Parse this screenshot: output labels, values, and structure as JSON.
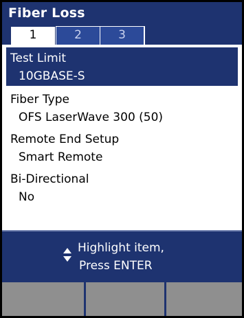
{
  "screen": {
    "title": "Fiber Loss",
    "tabs": [
      {
        "label": "1",
        "active": true
      },
      {
        "label": "2",
        "active": false
      },
      {
        "label": "3",
        "active": false
      }
    ]
  },
  "settings": [
    {
      "label": "Test Limit",
      "value": "10GBASE-S",
      "selected": true
    },
    {
      "label": "Fiber Type",
      "value": "OFS LaserWave 300 (50)",
      "selected": false
    },
    {
      "label": "Remote End Setup",
      "value": "Smart Remote",
      "selected": false
    },
    {
      "label": "Bi-Directional",
      "value": "No",
      "selected": false
    }
  ],
  "help": {
    "icon": "up-down-arrows-icon",
    "line1": "Highlight item,",
    "line2": "Press ENTER"
  },
  "softkeys": [
    {
      "label": ""
    },
    {
      "label": ""
    },
    {
      "label": ""
    }
  ],
  "colors": {
    "header_bg": "#1e3370",
    "inactive_tab": "#2c4a99",
    "softkey": "#8f8f8f",
    "frame": "#000000"
  }
}
